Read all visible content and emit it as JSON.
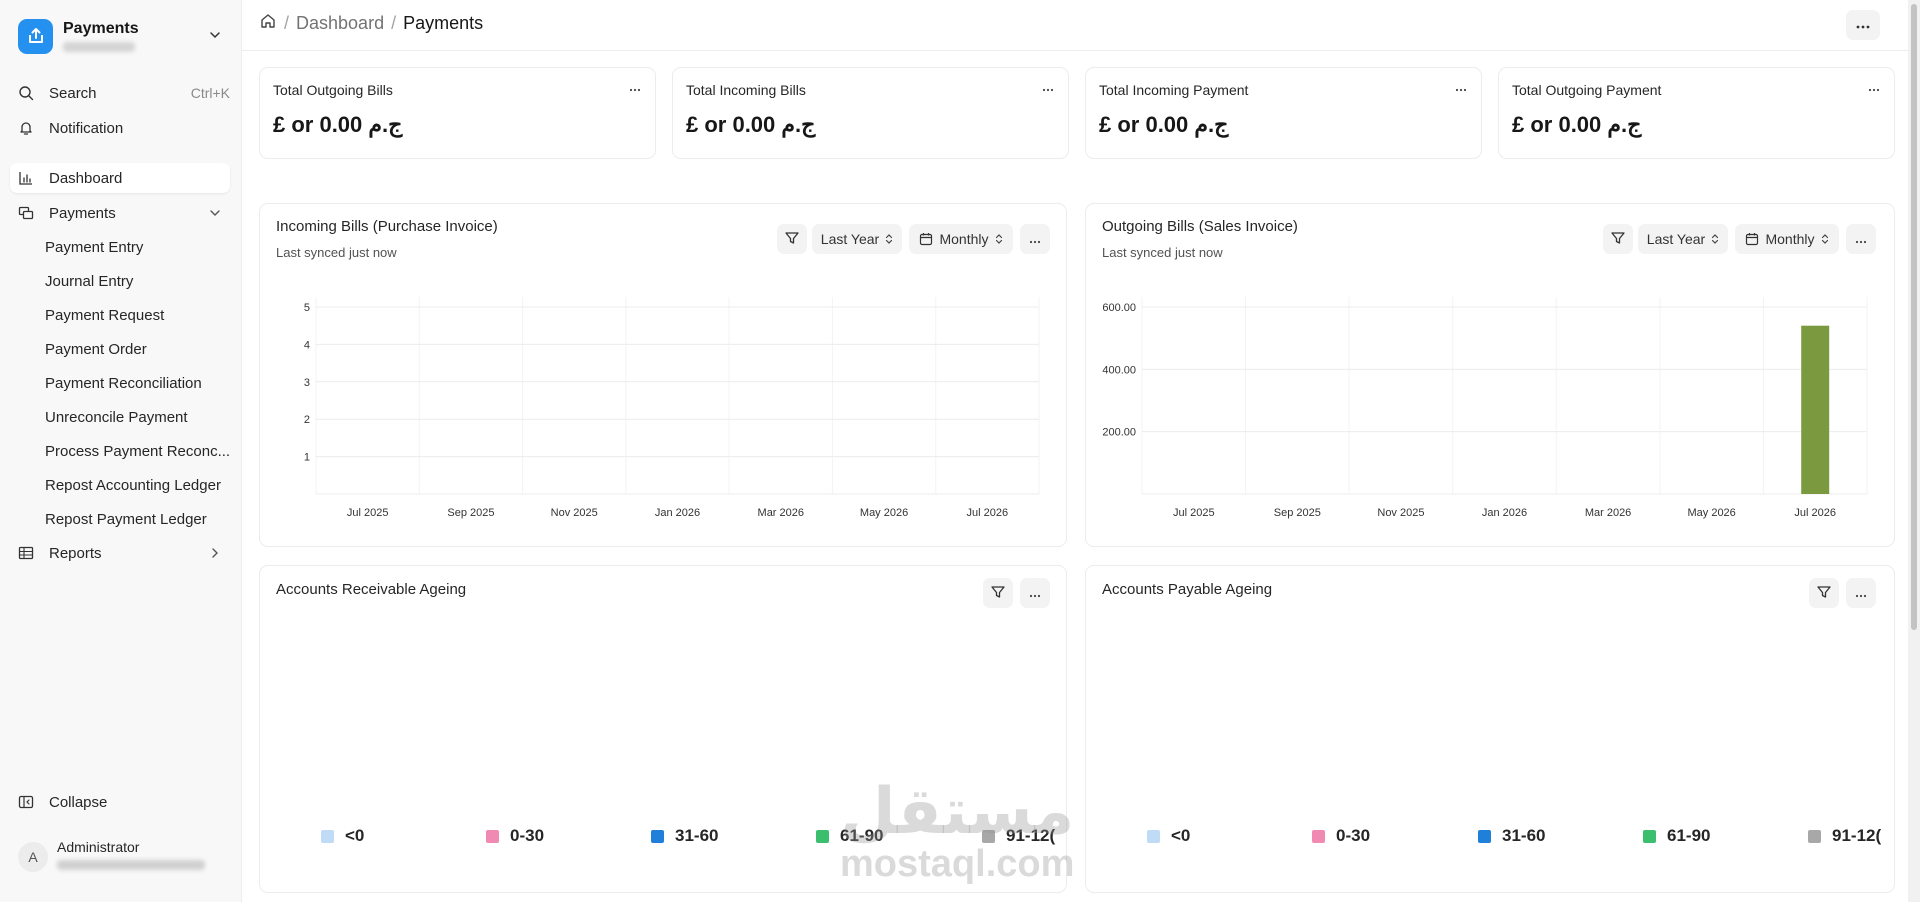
{
  "app": {
    "title": "Payments"
  },
  "sidebar": {
    "search": {
      "label": "Search",
      "shortcut": "Ctrl+K"
    },
    "notification": "Notification",
    "dashboard": "Dashboard",
    "payments": "Payments",
    "payment_items": [
      "Payment Entry",
      "Journal Entry",
      "Payment Request",
      "Payment Order",
      "Payment Reconciliation",
      "Unreconcile Payment",
      "Process Payment Reconc...",
      "Repost Accounting Ledger",
      "Repost Payment Ledger"
    ],
    "reports": "Reports",
    "collapse": "Collapse",
    "user": {
      "initial": "A",
      "name": "Administrator"
    }
  },
  "breadcrumb": {
    "parent": "Dashboard",
    "current": "Payments"
  },
  "stat_cards": [
    {
      "label": "Total Outgoing Bills",
      "value": "£ or 0.00 ج.م"
    },
    {
      "label": "Total Incoming Bills",
      "value": "£ or 0.00 ج.م"
    },
    {
      "label": "Total Incoming Payment",
      "value": "£ or 0.00 ج.م"
    },
    {
      "label": "Total Outgoing Payment",
      "value": "£ or 0.00 ج.م"
    }
  ],
  "incoming_chart": {
    "title": "Incoming Bills (Purchase Invoice)",
    "sync": "Last synced just now",
    "range": "Last Year",
    "interval": "Monthly"
  },
  "outgoing_chart": {
    "title": "Outgoing Bills (Sales Invoice)",
    "sync": "Last synced just now",
    "range": "Last Year",
    "interval": "Monthly"
  },
  "receivable": {
    "title": "Accounts Receivable Ageing"
  },
  "payable": {
    "title": "Accounts Payable Ageing"
  },
  "ageing_legend": [
    {
      "label": "<0",
      "color": "#bfdbf5"
    },
    {
      "label": "0-30",
      "color": "#f08ab3"
    },
    {
      "label": "31-60",
      "color": "#1f7fd9"
    },
    {
      "label": "61-90",
      "color": "#3bbf6f"
    },
    {
      "label": "91-12(",
      "color": "#a8a8a8"
    }
  ],
  "watermark": {
    "line1": "مستقل",
    "line2": "mostaql.com"
  },
  "chart_data": [
    {
      "type": "line",
      "title": "Incoming Bills (Purchase Invoice)",
      "x": [
        "Jul 2025",
        "Sep 2025",
        "Nov 2025",
        "Jan 2026",
        "Mar 2026",
        "May 2026",
        "Jul 2026"
      ],
      "yticks": [
        1,
        2,
        3,
        4,
        5
      ],
      "ylim": [
        0,
        5
      ],
      "series": [],
      "grid": true
    },
    {
      "type": "bar",
      "title": "Outgoing Bills (Sales Invoice)",
      "x": [
        "Jul 2025",
        "Sep 2025",
        "Nov 2025",
        "Jan 2026",
        "Mar 2026",
        "May 2026",
        "Jul 2026"
      ],
      "yticks": [
        "200.00",
        "400.00",
        "600.00"
      ],
      "ylim": [
        0,
        600
      ],
      "bars": [
        {
          "x": "Jul 2026",
          "value": 540
        }
      ],
      "bar_color": "#7b9a3f",
      "grid": true
    }
  ]
}
